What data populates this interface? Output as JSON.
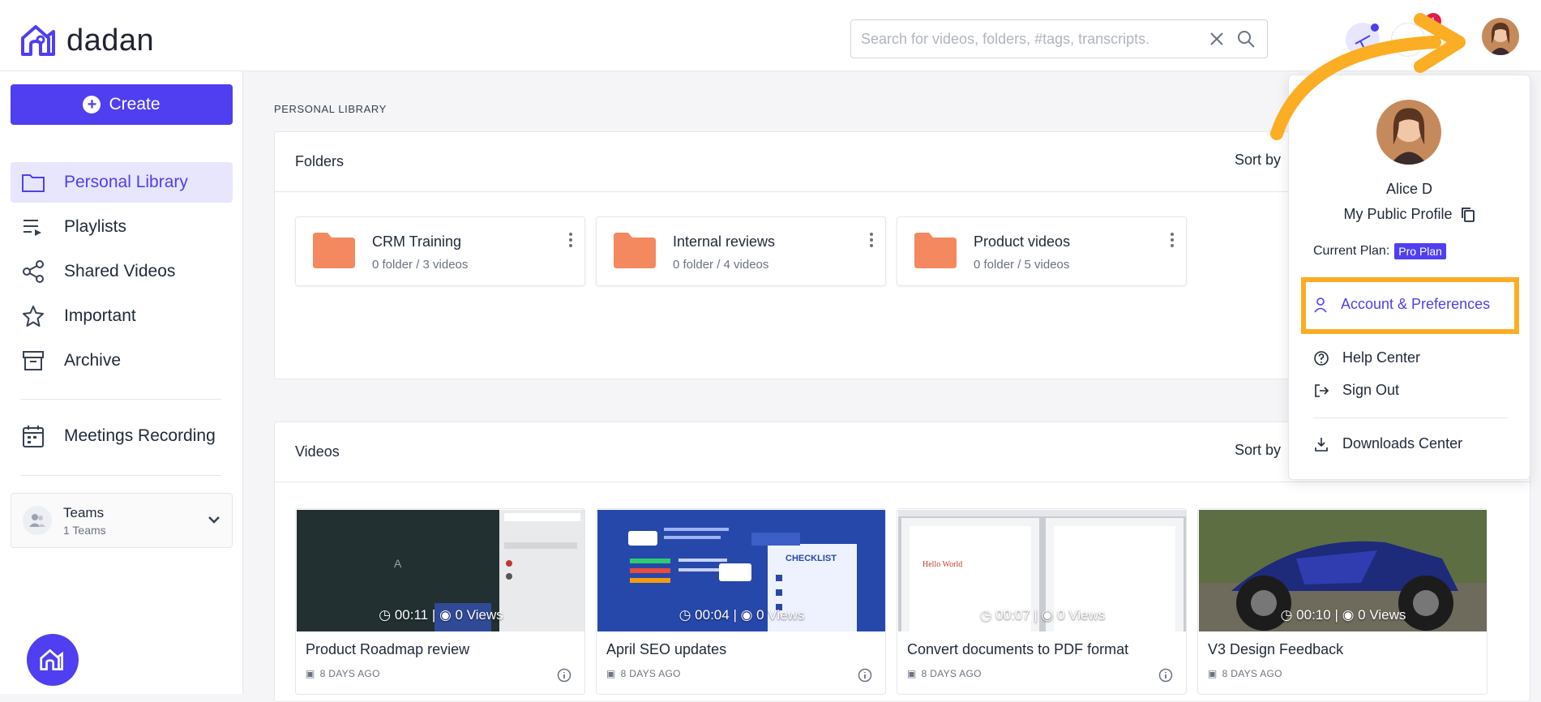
{
  "app": {
    "logo_text": "dadan"
  },
  "search": {
    "placeholder": "Search for videos, folders, #tags, transcripts."
  },
  "notifications": {
    "count": "1"
  },
  "sidebar": {
    "create_label": "Create",
    "items": [
      {
        "label": "Personal Library",
        "icon": "folder-icon",
        "active": true
      },
      {
        "label": "Playlists",
        "icon": "playlist-icon"
      },
      {
        "label": "Shared Videos",
        "icon": "share-icon"
      },
      {
        "label": "Important",
        "icon": "star-icon"
      },
      {
        "label": "Archive",
        "icon": "archive-icon"
      },
      {
        "label": "Meetings Recording",
        "icon": "calendar-icon"
      }
    ],
    "teams": {
      "title": "Teams",
      "subtitle": "1 Teams"
    }
  },
  "main": {
    "section_label": "PERSONAL LIBRARY",
    "folders_panel": {
      "title": "Folders",
      "sort_label": "Sort by"
    },
    "folders": [
      {
        "name": "CRM Training",
        "meta": "0 folder / 3 videos"
      },
      {
        "name": "Internal reviews",
        "meta": "0 folder / 4 videos"
      },
      {
        "name": "Product videos",
        "meta": "0 folder / 5 videos"
      }
    ],
    "videos_panel": {
      "title": "Videos",
      "sort_label": "Sort by"
    },
    "videos": [
      {
        "title": "Product Roadmap review",
        "duration": "00:11",
        "views": "0 Views",
        "age": "8 DAYS AGO",
        "thumb_text": "A"
      },
      {
        "title": "April SEO updates",
        "duration": "00:04",
        "views": "0 Views",
        "age": "8 DAYS AGO",
        "thumb_text": "CHECKLIST"
      },
      {
        "title": "Convert documents to PDF format",
        "duration": "00:07",
        "views": "0 Views",
        "age": "8 DAYS AGO",
        "thumb_text": "Hello World"
      },
      {
        "title": "V3 Design Feedback",
        "duration": "00:10",
        "views": "0 Views",
        "age": "8 DAYS AGO",
        "thumb_text": ""
      }
    ]
  },
  "profile_menu": {
    "name": "Alice D",
    "public_profile": "My Public Profile",
    "plan_label": "Current Plan:",
    "plan_badge": "Pro Plan",
    "items": [
      {
        "label": "Account & Preferences",
        "icon": "user-icon",
        "highlighted": true
      },
      {
        "label": "Help Center",
        "icon": "help-icon"
      },
      {
        "label": "Sign Out",
        "icon": "sign-out-icon"
      },
      {
        "label": "Downloads Center",
        "icon": "download-icon"
      }
    ]
  },
  "colors": {
    "accent": "#4f3ff0",
    "highlight": "#fbad23",
    "folder": "#f4895f"
  }
}
